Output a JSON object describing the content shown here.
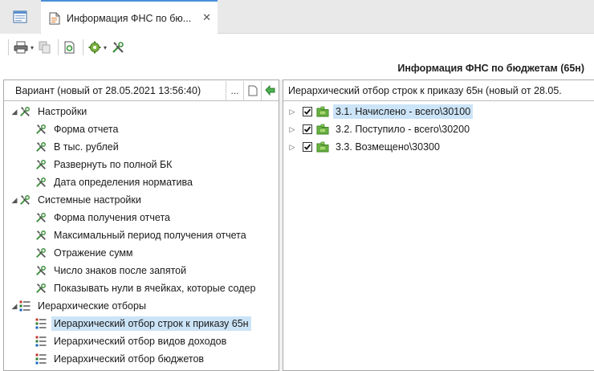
{
  "tab": {
    "title": "Информация ФНС по бю...",
    "close": "✕"
  },
  "toolbar": {
    "caret": "▾"
  },
  "report_title": "Информация ФНС по бюджетам (65н)",
  "left_panel": {
    "variant": "Вариант (новый от 28.05.2021 13:56:40)",
    "more_label": "...",
    "groups": [
      {
        "label": "Настройки",
        "items": [
          "Форма отчета",
          "В тыс. рублей",
          "Развернуть по полной БК",
          "Дата определения норматива"
        ]
      },
      {
        "label": "Системные настройки",
        "items": [
          "Форма получения отчета",
          "Максимальный период получения отчета",
          "Отражение сумм",
          "Число знаков после запятой",
          "Показывать нули в ячейках, которые содер"
        ]
      },
      {
        "label": "Иерархические отборы",
        "items": [
          "Иерархический отбор строк к приказу 65н",
          "Иерархический отбор видов доходов",
          "Иерархический отбор бюджетов"
        ]
      }
    ]
  },
  "right_panel": {
    "header": "Иерархический отбор строк к приказу 65н (новый от 28.05.",
    "rows": [
      "3.1. Начислено - всего\\30100",
      "3.2. Поступило - всего\\30200",
      "3.3. Возмещено\\30300"
    ]
  },
  "colors": {
    "accent": "#4a8fd8",
    "selection": "#cce4f7"
  },
  "icons": {
    "tool": "tools-icon",
    "hier": "hierarchy-icon",
    "folder": "green-folder-icon"
  }
}
